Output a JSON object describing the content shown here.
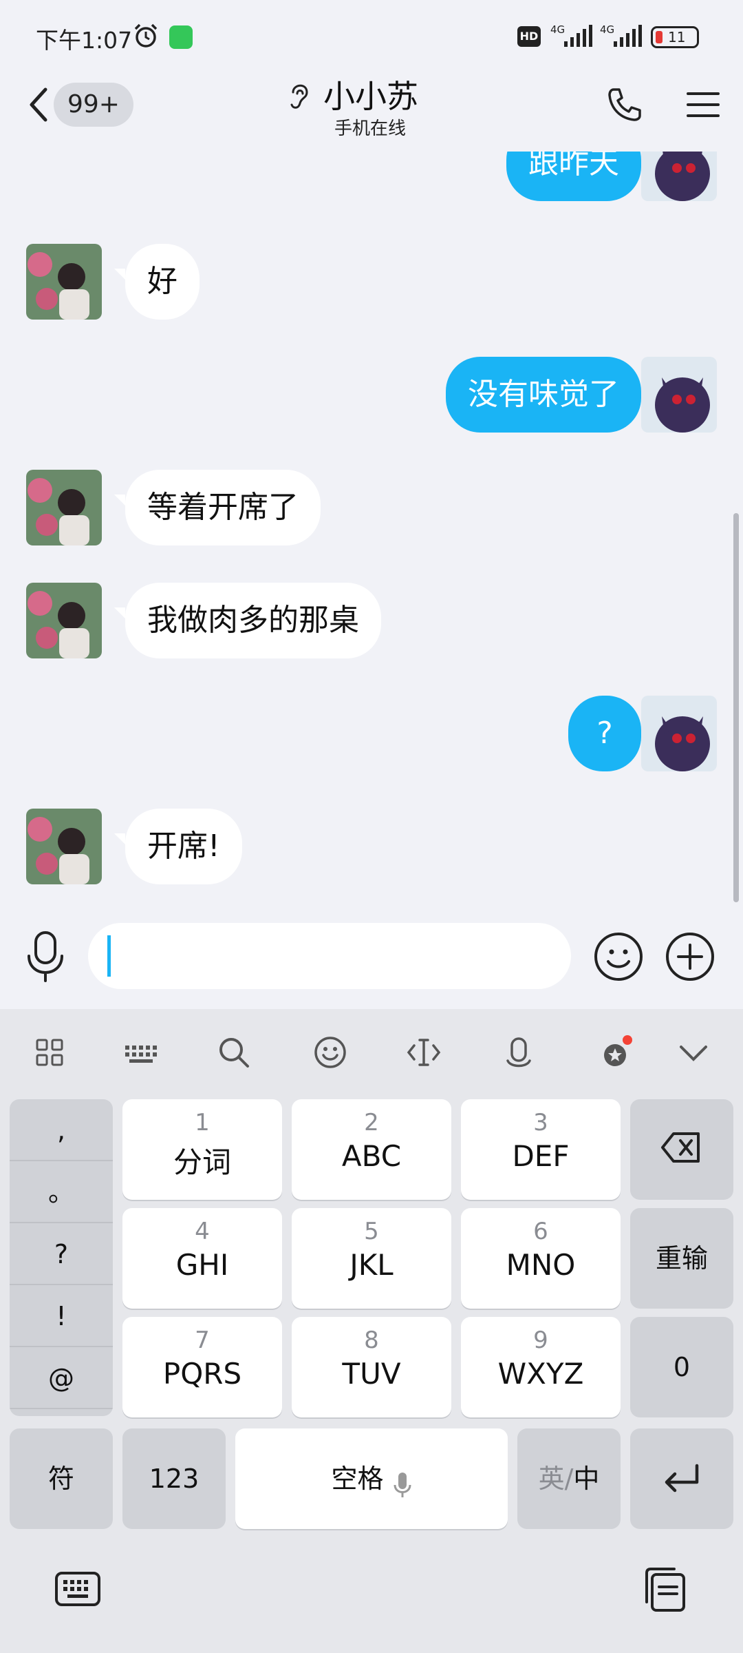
{
  "status_bar": {
    "time": "下午1:07",
    "hd": "HD",
    "net1": "4G",
    "net2": "4G",
    "battery": "11"
  },
  "header": {
    "unread_badge": "99+",
    "contact_name": "小小苏",
    "contact_status": "手机在线"
  },
  "messages": [
    {
      "side": "out",
      "text": "跟昨天"
    },
    {
      "side": "in",
      "text": "好"
    },
    {
      "side": "out",
      "text": "没有味觉了"
    },
    {
      "side": "in",
      "text": "等着开席了"
    },
    {
      "side": "in",
      "text": "我做肉多的那桌"
    },
    {
      "side": "out",
      "text": "?"
    },
    {
      "side": "in",
      "text": "开席!"
    }
  ],
  "input": {
    "value": ""
  },
  "keyboard": {
    "toolbar": [
      "grid-icon",
      "keyboard-layout-icon",
      "search-icon",
      "emoji-icon",
      "cursor-icon",
      "voice-icon",
      "badge-icon",
      "collapse-icon"
    ],
    "punctuation": [
      ",",
      "。",
      "?",
      "!",
      "@"
    ],
    "keys": [
      {
        "num": "1",
        "label": "分词"
      },
      {
        "num": "2",
        "label": "ABC"
      },
      {
        "num": "3",
        "label": "DEF"
      },
      {
        "num": "4",
        "label": "GHI"
      },
      {
        "num": "5",
        "label": "JKL"
      },
      {
        "num": "6",
        "label": "MNO"
      },
      {
        "num": "7",
        "label": "PQRS"
      },
      {
        "num": "8",
        "label": "TUV"
      },
      {
        "num": "9",
        "label": "WXYZ"
      }
    ],
    "reenter": "重输",
    "zero": "0",
    "symbols": "符",
    "num123": "123",
    "space": "空格",
    "lang_en": "英",
    "lang_sep": "/",
    "lang_zh": "中"
  },
  "colors": {
    "accent": "#1ab4f5",
    "background": "#f1f2f7",
    "keyboard_bg": "#e6e7eb"
  }
}
